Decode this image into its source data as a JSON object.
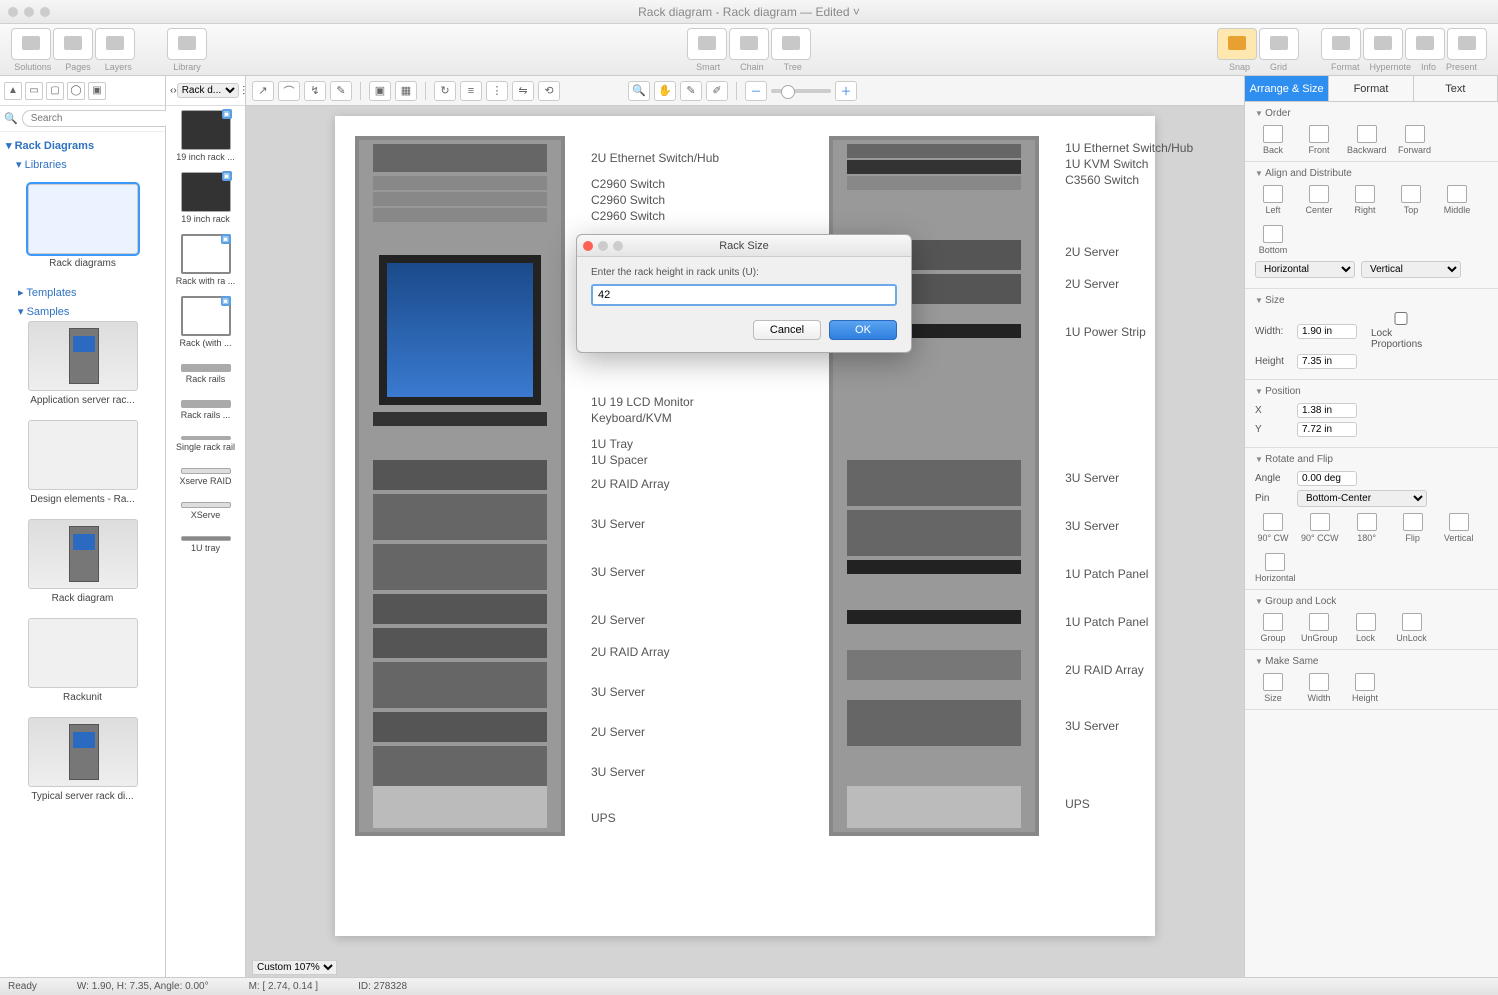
{
  "title": "Rack diagram - Rack diagram — Edited ˅",
  "toolbar": {
    "solutions": "Solutions",
    "pages": "Pages",
    "layers": "Layers",
    "library": "Library",
    "smart": "Smart",
    "chain": "Chain",
    "tree": "Tree",
    "snap": "Snap",
    "grid": "Grid",
    "format": "Format",
    "hypernote": "Hypernote",
    "info": "Info",
    "present": "Present"
  },
  "search": {
    "placeholder": "Search"
  },
  "tree": {
    "rack_diagrams": "Rack Diagrams",
    "libraries": "Libraries",
    "templates": "Templates",
    "samples": "Samples"
  },
  "thumbs": {
    "rack_diagrams": "Rack diagrams",
    "app": "Application server rac...",
    "design": "Design elements - Ra...",
    "rackdiag": "Rack diagram",
    "rackunit": "Rackunit",
    "typical": "Typical server rack di..."
  },
  "shapes_tab": "Rack d...",
  "shapes": {
    "r19": "19 inch rack ...",
    "r19b": "19 inch rack",
    "rwith": "Rack with ra ...",
    "rwith2": "Rack (with ...",
    "rails": "Rack rails",
    "rails2": "Rack rails ...",
    "single": "Single rack rail",
    "xraid": "Xserve RAID",
    "xserve": "XServe",
    "tray": "1U tray"
  },
  "rackA_labels": {
    "42": "2U Ethernet Switch/Hub",
    "40": "C2960 Switch",
    "39": "C2960 Switch",
    "38": "C2960 Switch",
    "27": "1U 19 LCD Monitor",
    "26": "Keyboard/KVM",
    "25": "1U Tray",
    "24": "1U Spacer",
    "23": "2U RAID Array",
    "21": "3U Server",
    "18": "3U Server",
    "15": "2U Server",
    "13": "2U RAID Array",
    "11": "3U Server",
    "8": "2U Server",
    "6": "3U Server",
    "3": "UPS"
  },
  "rackB_labels": {
    "42": "1U Ethernet Switch/Hub",
    "41": "1U KVM Switch",
    "40": "C3560 Switch",
    "36": "2U Server",
    "34": "2U Server",
    "31": "1U Power Strip",
    "23": "3U Server",
    "20": "3U Server",
    "17": "1U Patch Panel",
    "14": "1U Patch Panel",
    "11": "2U RAID Array",
    "8": "3U Server",
    "3": "UPS"
  },
  "modal": {
    "title": "Rack Size",
    "label": "Enter the rack height in rack units (U):",
    "value": "42",
    "cancel": "Cancel",
    "ok": "OK"
  },
  "rp": {
    "tab_arrange": "Arrange & Size",
    "tab_format": "Format",
    "tab_text": "Text",
    "order": "Order",
    "back": "Back",
    "front": "Front",
    "backward": "Backward",
    "forward": "Forward",
    "align": "Align and Distribute",
    "left": "Left",
    "center": "Center",
    "right": "Right",
    "top": "Top",
    "middle": "Middle",
    "bottom": "Bottom",
    "horizontal": "Horizontal",
    "vertical": "Vertical",
    "size": "Size",
    "width_l": "Width:",
    "width_v": "1.90 in",
    "height_l": "Height",
    "height_v": "7.35 in",
    "lock": "Lock Proportions",
    "position": "Position",
    "x": "X",
    "x_v": "1.38 in",
    "y": "Y",
    "y_v": "7.72 in",
    "rotate": "Rotate and Flip",
    "angle": "Angle",
    "angle_v": "0.00 deg",
    "pin": "Pin",
    "pin_v": "Bottom-Center",
    "cw": "90° CW",
    "ccw": "90° CCW",
    "180": "180°",
    "flip": "Flip",
    "vertical2": "Vertical",
    "horizontal2": "Horizontal",
    "group": "Group and Lock",
    "grp": "Group",
    "ungrp": "UnGroup",
    "lck": "Lock",
    "unlck": "UnLock",
    "makesame": "Make Same",
    "sz": "Size",
    "wd": "Width",
    "ht": "Height"
  },
  "status": {
    "ready": "Ready",
    "wh": "W: 1.90,  H: 7.35,  Angle: 0.00°",
    "m": "M: [ 2.74, 0.14 ]",
    "id": "ID: 278328",
    "zoom": "Custom 107%"
  }
}
